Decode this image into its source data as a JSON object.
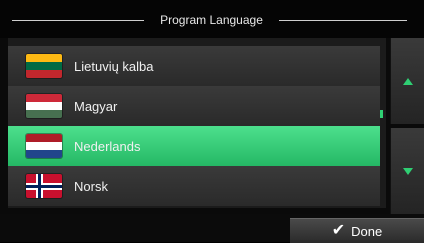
{
  "header": {
    "title": "Program Language"
  },
  "languages": [
    {
      "label": "Lietuvių kalba",
      "flag": "lithuania-flag",
      "colors": [
        "#fdb913",
        "#006a44",
        "#c1272d"
      ],
      "selected": false
    },
    {
      "label": "Magyar",
      "flag": "hungary-flag",
      "colors": [
        "#ce2939",
        "#ffffff",
        "#477050"
      ],
      "selected": false
    },
    {
      "label": "Nederlands",
      "flag": "netherlands-flag",
      "colors": [
        "#ae1c28",
        "#ffffff",
        "#21468b"
      ],
      "selected": true
    },
    {
      "label": "Norsk",
      "flag": "norway-flag",
      "colors": [
        "#c8102e",
        "#ffffff",
        "#00205b"
      ],
      "selected": false
    }
  ],
  "controls": {
    "up_icon": "triangle-up-icon",
    "down_icon": "triangle-down-icon",
    "done_label": "Done",
    "done_icon": "checkmark-icon"
  },
  "colors": {
    "accent": "#2fcf73",
    "selected_row": "#34c774"
  }
}
